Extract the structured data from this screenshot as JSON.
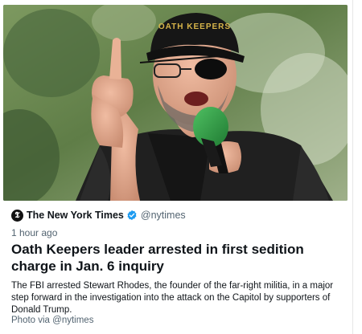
{
  "card": {
    "photo": {
      "icon": "news-photo",
      "cap_text": "OATH KEEPERS"
    },
    "source": {
      "logo_glyph": "𝕿",
      "name": "The New York Times",
      "verified_icon": "verified-badge-icon",
      "handle": "@nytimes"
    },
    "timestamp": "1 hour ago",
    "headline": "Oath Keepers leader arrested in first sedition charge in Jan. 6 inquiry",
    "summary": "The FBI arrested Stewart Rhodes, the founder of the far-right militia, in a major step forward in the investigation into the attack on the Capitol by supporters of Donald Trump.",
    "credit": "Photo via @nytimes"
  },
  "colors": {
    "text_primary": "#0f1419",
    "text_secondary": "#536471",
    "verified": "#1d9bf0",
    "microphone": "#2e9a43"
  }
}
